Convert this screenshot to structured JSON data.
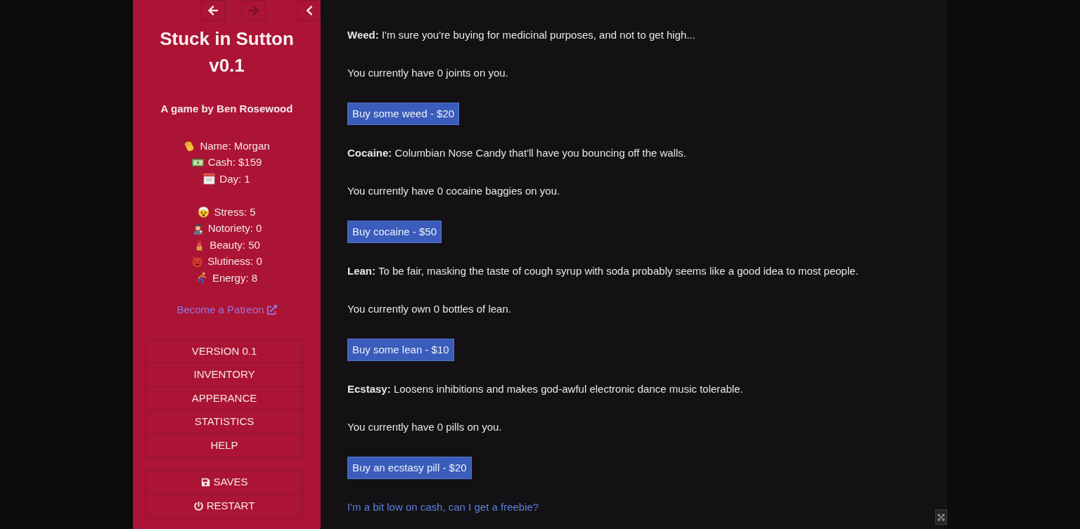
{
  "nav_buttons": [
    {
      "kind": "back",
      "disabled": false
    },
    {
      "kind": "forward",
      "disabled": true
    }
  ],
  "sidebar": {
    "title": "Stuck in Sutton v0.1",
    "subtitle": "A game by Ben Rosewood",
    "stat_groups": [
      {
        "items": [
          "Name: Morgan",
          "Cash: $159",
          "Day: 1"
        ]
      },
      {
        "items": [
          "Stress: 5",
          "Notoriety: 0",
          "Beauty: 50",
          "Slutiness: 0",
          "Energy: 8"
        ]
      }
    ],
    "patreon_link": "Become a Patreon",
    "menu": [
      {
        "label": "VERSION 0.1"
      },
      {
        "label": "INVENTORY"
      },
      {
        "label": "APPERANCE"
      },
      {
        "label": "STATISTICS"
      },
      {
        "label": "HELP"
      }
    ],
    "system_menu": [
      {
        "label": "SAVES",
        "kind": "save"
      },
      {
        "label": "RESTART",
        "kind": "restart"
      }
    ]
  },
  "items": [
    {
      "description": "**Weed:** I'm sure you're buying for medicinal purposes, and not to get high...",
      "count": "You currently have 0 joints on you.",
      "button": "Buy some weed - $20"
    },
    {
      "description": "**Cocaine:** Columbian Nose Candy that'll have you bouncing off the walls.",
      "count": "You currently have 0 cocaine baggies on you.",
      "button": "Buy cocaine - $50"
    },
    {
      "description": "**Lean:** To be fair, masking the taste of cough syrup with soda probably seems like a good idea to most people.",
      "count": "You currently own 0 bottles of lean.",
      "button": "Buy some lean - $10"
    },
    {
      "description": "**Ecstasy:** Loosens inhibitions and makes god-awful electronic dance music tolerable.",
      "count": "You currently have 0 pills on you.",
      "button": "Buy an ecstasy pill - $20"
    }
  ],
  "freebie_link": "I'm a bit low on cash, can I get a freebie?"
}
